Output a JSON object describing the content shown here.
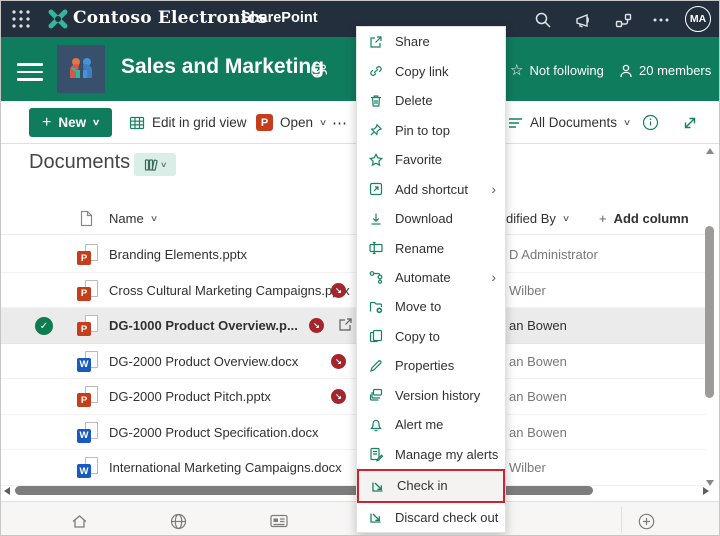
{
  "topbar": {
    "brand": "Contoso Electronics",
    "product": "SharePoint",
    "avatar_initials": "MA"
  },
  "site": {
    "title": "Sales and Marketing",
    "following_label": "Not following",
    "members_label": "20 members"
  },
  "toolbar": {
    "new_label": "New",
    "edit_grid_label": "Edit in grid view",
    "open_label": "Open",
    "view_label": "All Documents"
  },
  "library": {
    "heading": "Documents"
  },
  "table": {
    "columns": {
      "name": "Name",
      "modified_by_visible": "dified By",
      "add_column": "Add column"
    },
    "rows": [
      {
        "name": "Branding Elements.pptx",
        "type": "pptx",
        "modified_by": "D Administrator",
        "checked_out": false,
        "selected": false
      },
      {
        "name": "Cross Cultural Marketing Campaigns.pptx",
        "type": "pptx",
        "modified_by": "Wilber",
        "checked_out": true,
        "selected": false
      },
      {
        "name": "DG-1000 Product Overview.p...",
        "type": "pptx",
        "modified_by": "an Bowen",
        "checked_out": true,
        "selected": true
      },
      {
        "name": "DG-2000 Product Overview.docx",
        "type": "docx",
        "modified_by": "an Bowen",
        "checked_out": true,
        "selected": false
      },
      {
        "name": "DG-2000 Product Pitch.pptx",
        "type": "pptx",
        "modified_by": "an Bowen",
        "checked_out": true,
        "selected": false
      },
      {
        "name": "DG-2000 Product Specification.docx",
        "type": "docx",
        "modified_by": "an Bowen",
        "checked_out": false,
        "selected": false
      },
      {
        "name": "International Marketing Campaigns.docx",
        "type": "docx",
        "modified_by": "Wilber",
        "checked_out": false,
        "selected": false
      }
    ]
  },
  "menu": {
    "items": [
      {
        "label": "Share"
      },
      {
        "label": "Copy link"
      },
      {
        "label": "Delete"
      },
      {
        "label": "Pin to top"
      },
      {
        "label": "Favorite"
      },
      {
        "label": "Add shortcut",
        "submenu": true
      },
      {
        "label": "Download"
      },
      {
        "label": "Rename"
      },
      {
        "label": "Automate",
        "submenu": true
      },
      {
        "label": "Move to"
      },
      {
        "label": "Copy to"
      },
      {
        "label": "Properties"
      },
      {
        "label": "Version history"
      },
      {
        "label": "Alert me"
      },
      {
        "label": "Manage my alerts"
      },
      {
        "label": "Check in",
        "highlighted": true
      },
      {
        "label": "Discard check out"
      }
    ]
  },
  "icons": {
    "plus": "+",
    "check": "✓",
    "checkout_arrow": "↘",
    "ellipsis": "⋯",
    "chevron_down": "∨",
    "chevron_right": "›",
    "star": "☆",
    "pptx_letter": "P",
    "docx_letter": "W"
  },
  "colors": {
    "topbar": "#242f3d",
    "theme_green": "#107c5e",
    "accent_teal": "#168264",
    "checkout_red": "#a4262c",
    "highlight_red": "#cf2130"
  }
}
